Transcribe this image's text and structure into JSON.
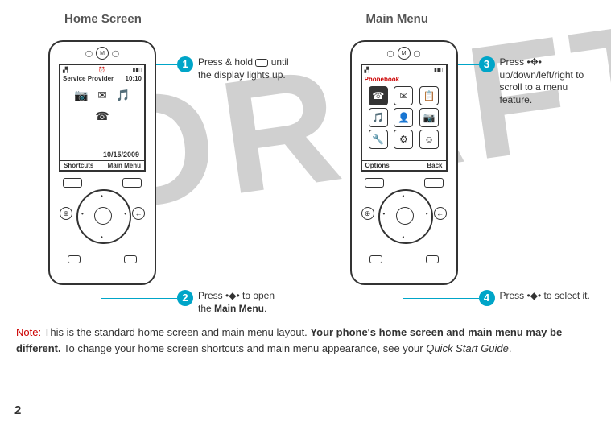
{
  "watermark": "DRAFT",
  "page_number": "2",
  "sections": {
    "home": {
      "title": "Home Screen",
      "provider": "Service Provider",
      "time": "10:10",
      "date": "10/15/2009",
      "soft_left": "Shortcuts",
      "soft_right": "Main Menu"
    },
    "menu": {
      "title": "Main Menu",
      "current": "Phonebook",
      "soft_left": "Options",
      "soft_right": "Back"
    }
  },
  "callouts": {
    "c1": {
      "num": "1",
      "text_a": "Press & hold ",
      "text_b": " until the display lights up."
    },
    "c2": {
      "num": "2",
      "text_a": "Press ",
      "nav": "•◆•",
      "text_b": " to open the ",
      "bold": "Main Menu",
      "text_c": "."
    },
    "c3": {
      "num": "3",
      "text_a": "Press ",
      "nav": "•✥•",
      "text_b": " up/down/left/right to scroll to a menu feature."
    },
    "c4": {
      "num": "4",
      "text_a": "Press ",
      "nav": "•◆•",
      "text_b": " to select it."
    }
  },
  "note": {
    "label": "Note:",
    "a": " This is the standard home screen and main menu layout. ",
    "bold": "Your phone's home screen and main menu may be different.",
    "b": " To change your home screen shortcuts and main menu appearance, see your ",
    "italic": "Quick Start Guide",
    "c": "."
  }
}
